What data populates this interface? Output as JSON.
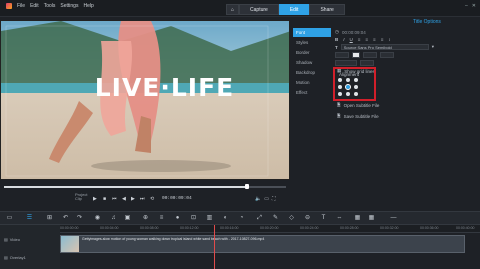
{
  "menu": {
    "items": [
      "File",
      "Edit",
      "Tools",
      "Settings",
      "Help"
    ]
  },
  "tabs": {
    "home_icon": "home-icon",
    "items": [
      "Capture",
      "Edit",
      "Share"
    ],
    "active": "Edit"
  },
  "preview": {
    "title_text": "LIVE·LIFE"
  },
  "transport": {
    "label_line1": "Project",
    "label_line2": "Clip",
    "timecode": "00:00:09:04",
    "progress": 0.86
  },
  "sidenav": {
    "items": [
      "Font",
      "Styles",
      "Border",
      "Shadow",
      "Backdrop",
      "Motion",
      "Effect"
    ],
    "active": "Font"
  },
  "panel": {
    "title": "Title Options",
    "timecode": "00:00:09:04",
    "font_name": "Source Sans Pro Semibold",
    "grid_label": "Show grid lines",
    "alignment_label": "Alignment",
    "open_subtitle": "Open Subtitle File",
    "save_subtitle": "Save Subtitle File"
  },
  "timeline": {
    "ruler": [
      "00:00:00:00",
      "00:00:04:00",
      "00:00:08:00",
      "00:00:12:00",
      "00:00:16:00",
      "00:00:20:00",
      "00:00:24:00",
      "00:00:28:00",
      "00:00:32:00",
      "00:00:36:00",
      "00:00:40:00"
    ],
    "tracks": [
      {
        "label": "Video"
      },
      {
        "label": "Overlay1"
      }
    ],
    "clip_name": "Gettyimages-slow motion of young woman walking down tropical island white sand beach with - 2017-10827-096.mp4"
  },
  "colors": {
    "accent": "#2fa2e6",
    "highlight": "#d21f2a"
  }
}
